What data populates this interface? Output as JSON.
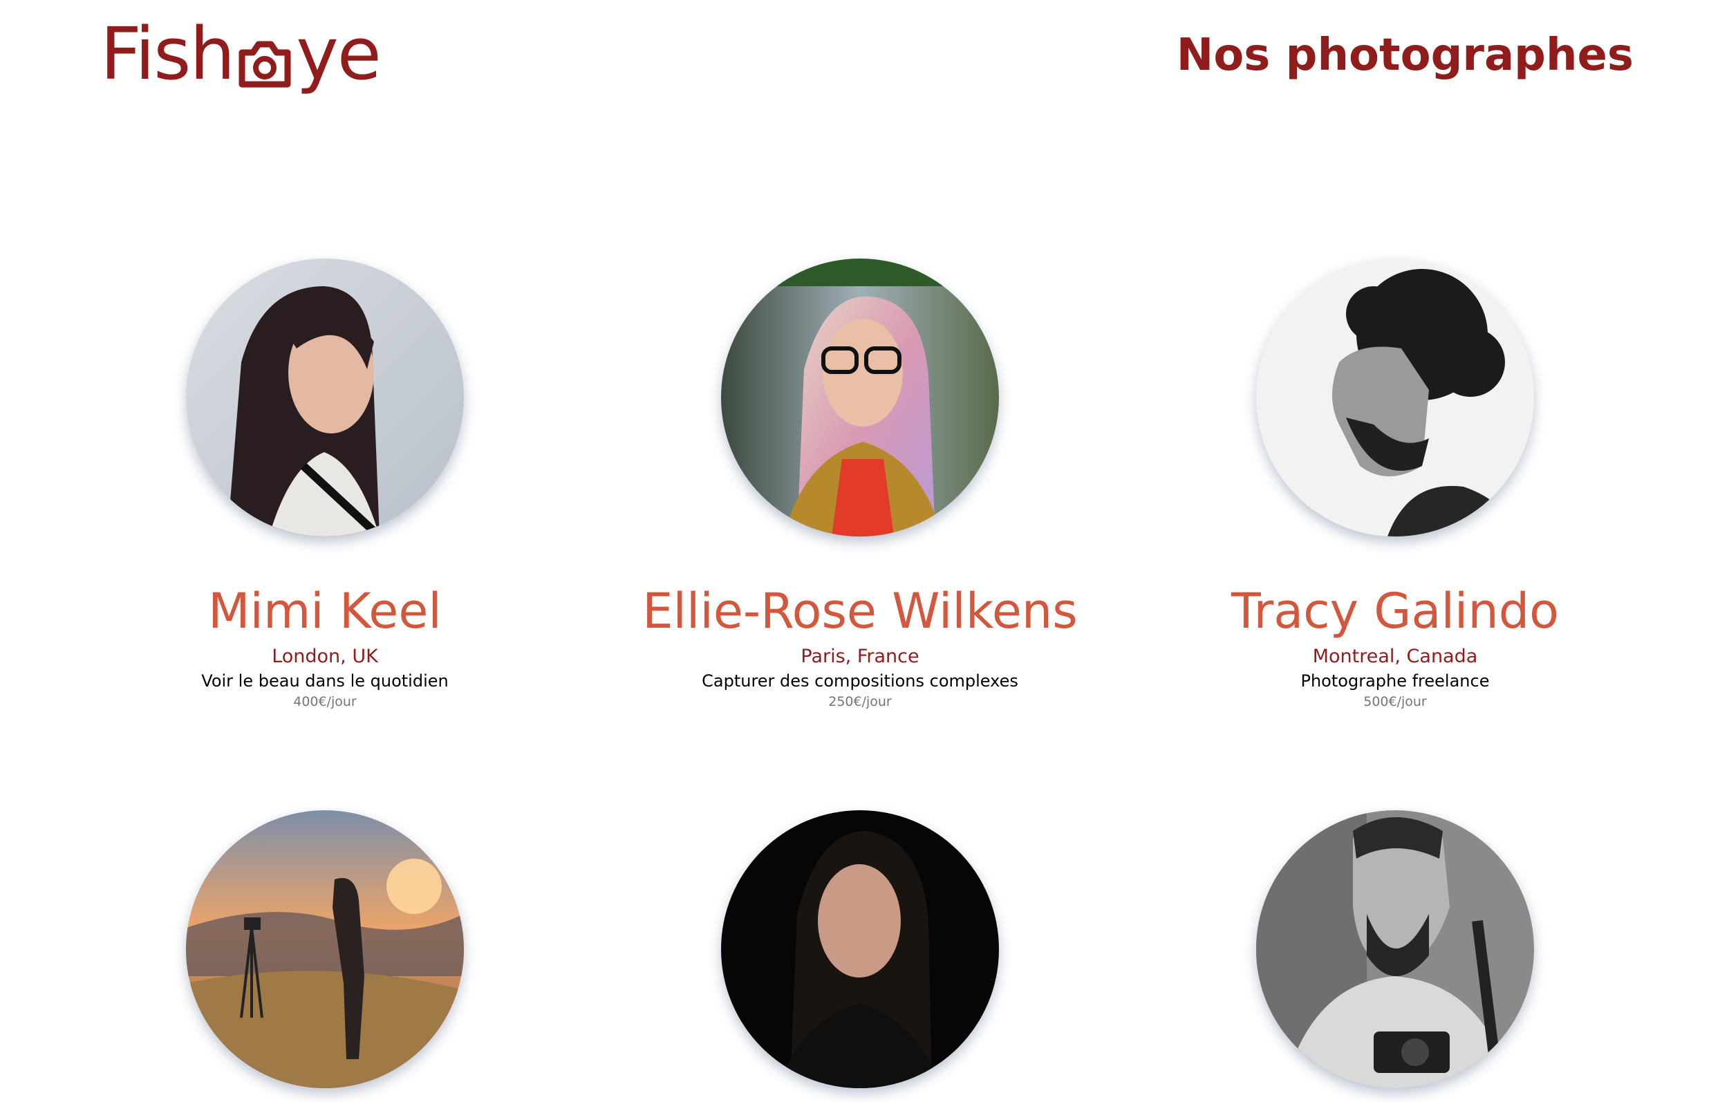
{
  "header": {
    "logo_text_left": "Fish",
    "logo_text_right": "ye",
    "title": "Nos photographes"
  },
  "colors": {
    "brand": "#901C1C",
    "name": "#D3573C",
    "price": "#757575"
  },
  "photographers": [
    {
      "name": "Mimi Keel",
      "location": "London, UK",
      "tagline": "Voir le beau dans le quotidien",
      "price": "400€/jour",
      "portrait": "portrait-woman-dark-hair-grey-background"
    },
    {
      "name": "Ellie-Rose Wilkens",
      "location": "Paris, France",
      "tagline": "Capturer des compositions complexes",
      "price": "250€/jour",
      "portrait": "portrait-woman-pastel-hair-glasses"
    },
    {
      "name": "Tracy Galindo",
      "location": "Montreal, Canada",
      "tagline": "Photographe freelance",
      "price": "500€/jour",
      "portrait": "portrait-man-curly-hair-bw"
    },
    {
      "portrait": "photographer-sunset-tripod"
    },
    {
      "portrait": "portrait-woman-dark-background"
    },
    {
      "portrait": "portrait-man-beard-camera-bw"
    }
  ]
}
